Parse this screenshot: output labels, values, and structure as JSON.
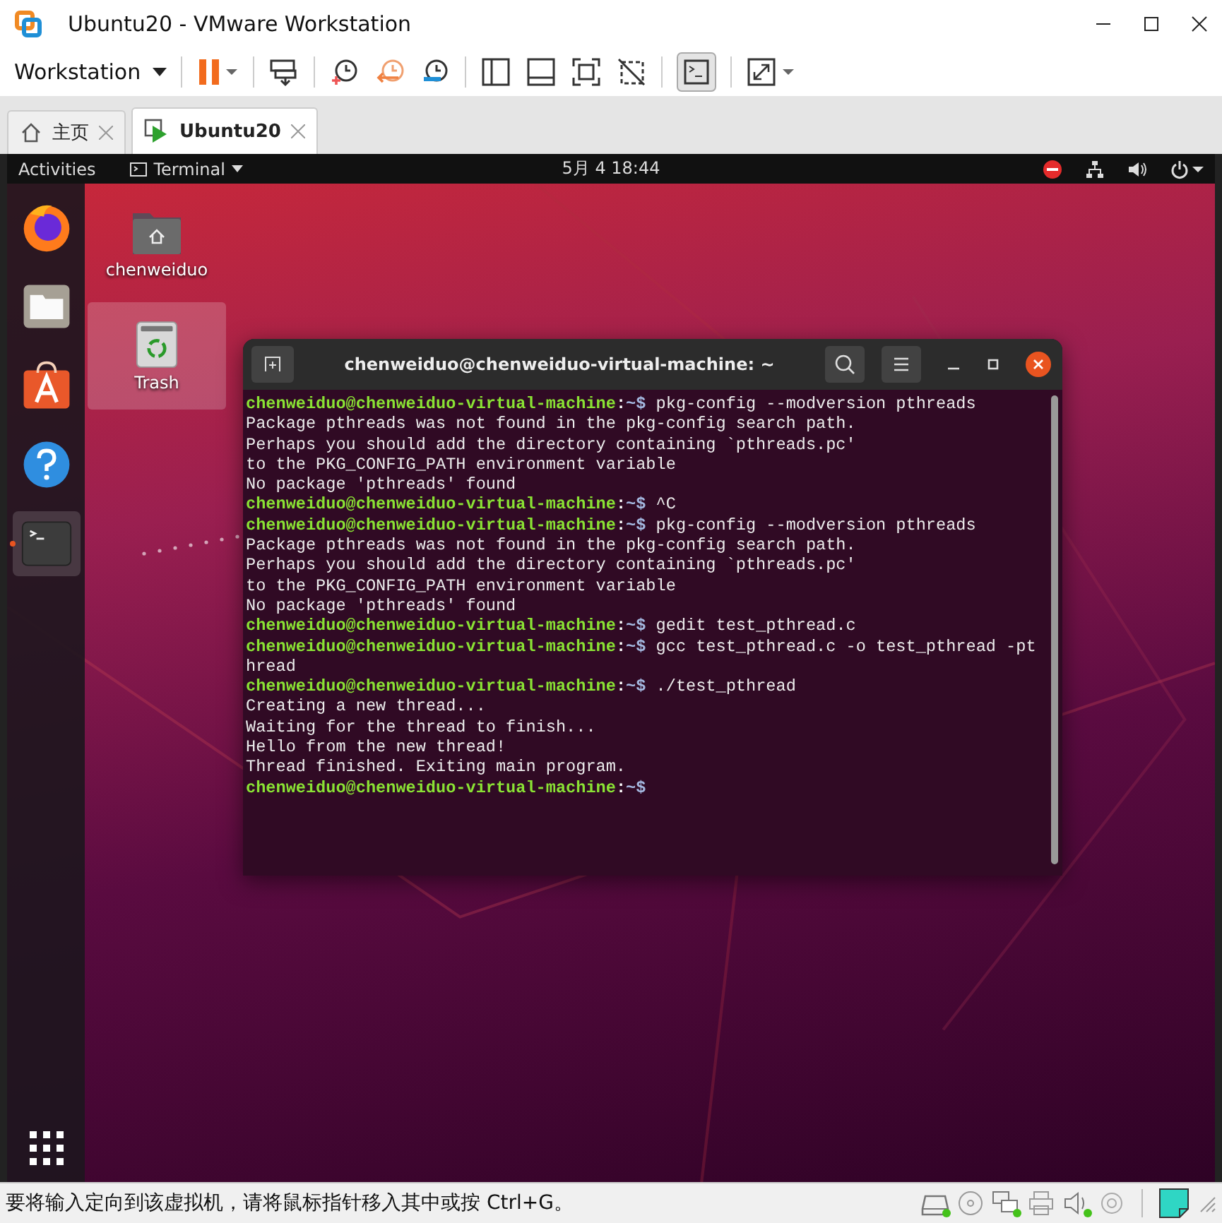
{
  "window": {
    "title": "Ubuntu20 - VMware Workstation"
  },
  "toolbar": {
    "menu_label": "Workstation"
  },
  "tabs": [
    {
      "label": "主页",
      "kind": "home",
      "selected": false
    },
    {
      "label": "Ubuntu20",
      "kind": "vm",
      "selected": true
    }
  ],
  "topbar": {
    "activities": "Activities",
    "app_menu": "Terminal",
    "clock": "5月 4  18:44"
  },
  "desktop_icons": [
    {
      "label": "chenweiduo",
      "kind": "home",
      "selected": false
    },
    {
      "label": "Trash",
      "kind": "trash",
      "selected": true
    }
  ],
  "dock": [
    {
      "kind": "firefox",
      "running": false
    },
    {
      "kind": "files",
      "running": false
    },
    {
      "kind": "software",
      "running": false
    },
    {
      "kind": "help",
      "running": false
    },
    {
      "kind": "terminal",
      "running": true
    }
  ],
  "terminal": {
    "title": "chenweiduo@chenweiduo-virtual-machine: ~",
    "lines": [
      {
        "kind": "prompt",
        "user": "chenweiduo@chenweiduo-virtual-machine",
        "sep": ":",
        "path": "~$",
        "command": "pkg-config --modversion pthreads"
      },
      {
        "kind": "output",
        "text": "Package pthreads was not found in the pkg-config search path."
      },
      {
        "kind": "output",
        "text": "Perhaps you should add the directory containing `pthreads.pc'"
      },
      {
        "kind": "output",
        "text": "to the PKG_CONFIG_PATH environment variable"
      },
      {
        "kind": "output",
        "text": "No package 'pthreads' found"
      },
      {
        "kind": "prompt",
        "user": "chenweiduo@chenweiduo-virtual-machine",
        "sep": ":",
        "path": "~$",
        "command": "^C"
      },
      {
        "kind": "prompt",
        "user": "chenweiduo@chenweiduo-virtual-machine",
        "sep": ":",
        "path": "~$",
        "command": "pkg-config --modversion pthreads"
      },
      {
        "kind": "output",
        "text": "Package pthreads was not found in the pkg-config search path."
      },
      {
        "kind": "output",
        "text": "Perhaps you should add the directory containing `pthreads.pc'"
      },
      {
        "kind": "output",
        "text": "to the PKG_CONFIG_PATH environment variable"
      },
      {
        "kind": "output",
        "text": "No package 'pthreads' found"
      },
      {
        "kind": "prompt",
        "user": "chenweiduo@chenweiduo-virtual-machine",
        "sep": ":",
        "path": "~$",
        "command": "gedit test_pthread.c"
      },
      {
        "kind": "prompt",
        "user": "chenweiduo@chenweiduo-virtual-machine",
        "sep": ":",
        "path": "~$",
        "command": "gcc test_pthread.c -o test_pthread -pthread"
      },
      {
        "kind": "prompt",
        "user": "chenweiduo@chenweiduo-virtual-machine",
        "sep": ":",
        "path": "~$",
        "command": "./test_pthread"
      },
      {
        "kind": "output",
        "text": "Creating a new thread..."
      },
      {
        "kind": "output",
        "text": "Waiting for the thread to finish..."
      },
      {
        "kind": "output",
        "text": "Hello from the new thread!"
      },
      {
        "kind": "output",
        "text": "Thread finished. Exiting main program."
      },
      {
        "kind": "prompt",
        "user": "chenweiduo@chenweiduo-virtual-machine",
        "sep": ":",
        "path": "~$"
      }
    ]
  },
  "status_bar": {
    "message": "要将输入定向到该虚拟机，请将鼠标指针移入其中或按 Ctrl+G。",
    "devices": [
      {
        "kind": "disk",
        "active": true
      },
      {
        "kind": "cd",
        "active": false
      },
      {
        "kind": "network",
        "active": true
      },
      {
        "kind": "printer",
        "active": false
      },
      {
        "kind": "sound",
        "active": true
      },
      {
        "kind": "camera",
        "active": false
      }
    ]
  }
}
